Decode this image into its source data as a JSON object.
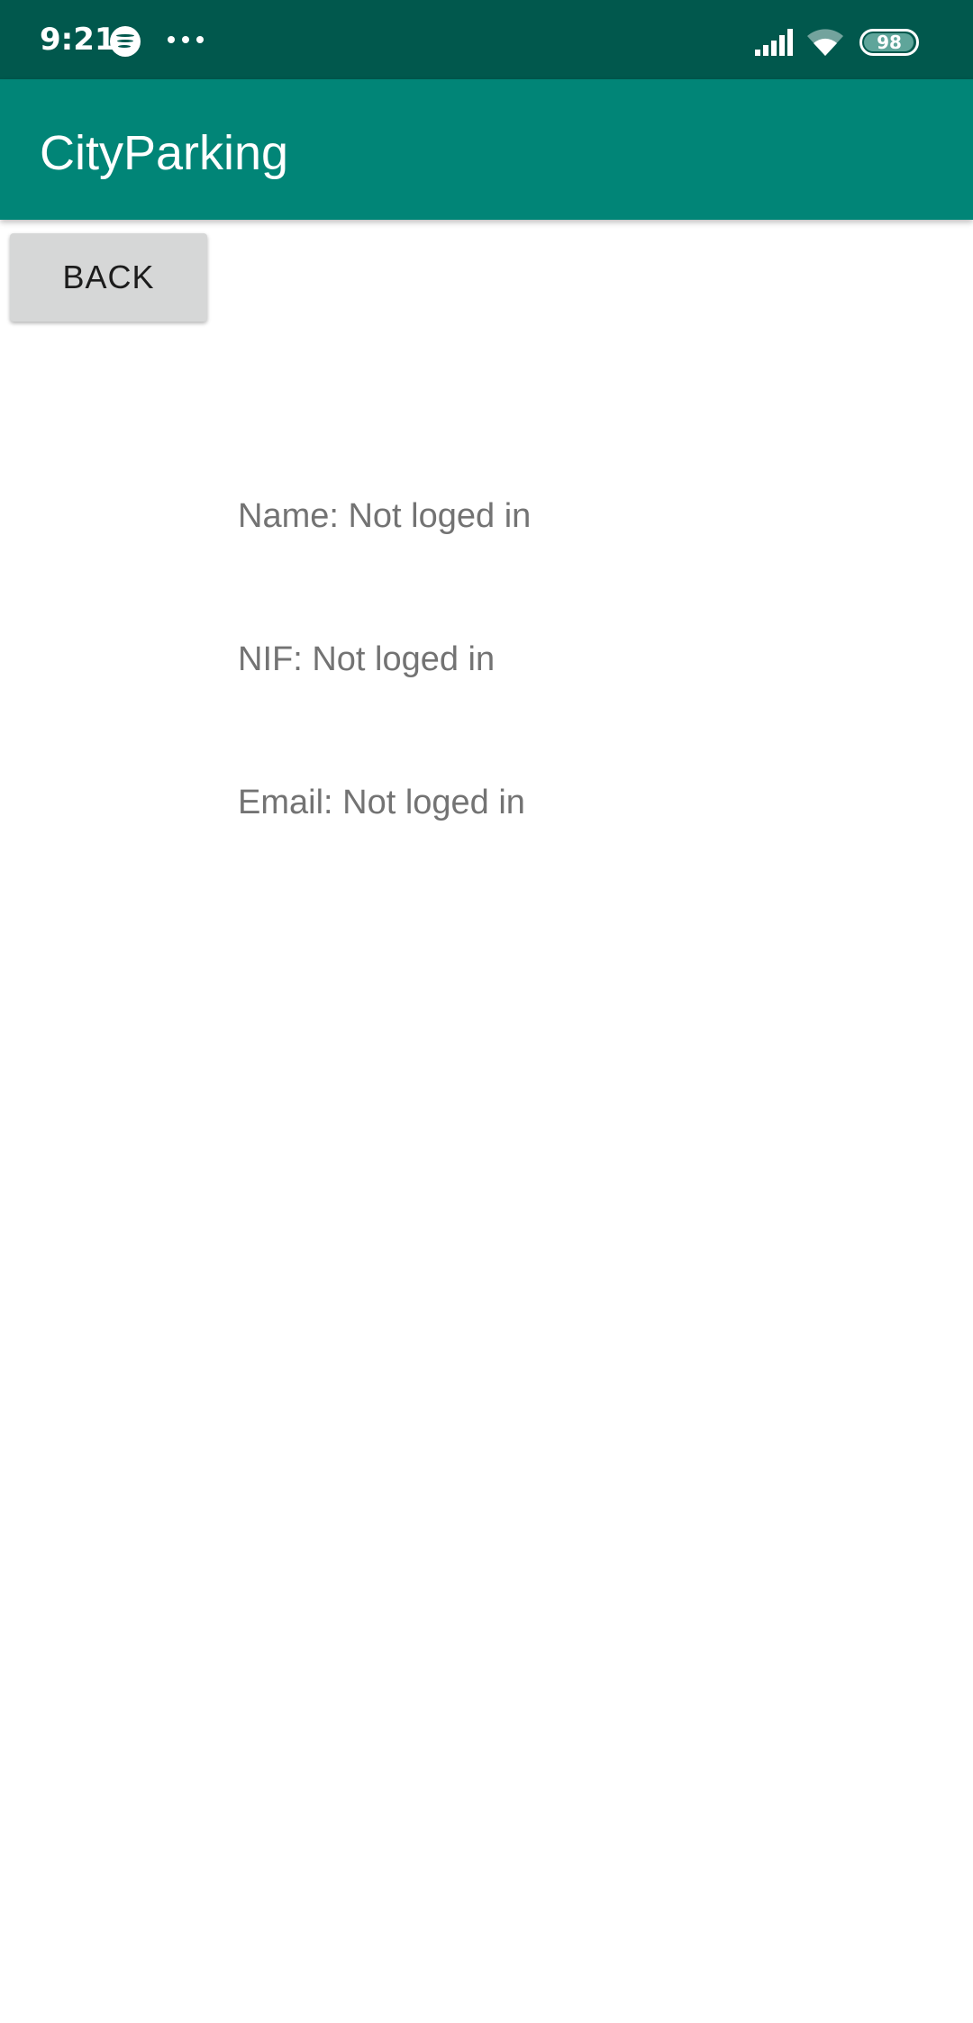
{
  "status_bar": {
    "time": "9:21",
    "battery_level": "98",
    "battery_fraction": 0.98,
    "icons": [
      "spotify-icon",
      "more-dots-icon",
      "signal-icon",
      "wifi-icon",
      "battery-icon"
    ]
  },
  "app_bar": {
    "title": "CityParking"
  },
  "back_button": {
    "label": "BACK"
  },
  "profile": {
    "name": "Name: Not loged in",
    "nif": "NIF: Not loged in",
    "email": "Email: Not loged in"
  },
  "colors": {
    "status_bar": "#01584d",
    "app_bar": "#018577",
    "button_bg": "#d6d7d7",
    "info_text": "#737373"
  }
}
